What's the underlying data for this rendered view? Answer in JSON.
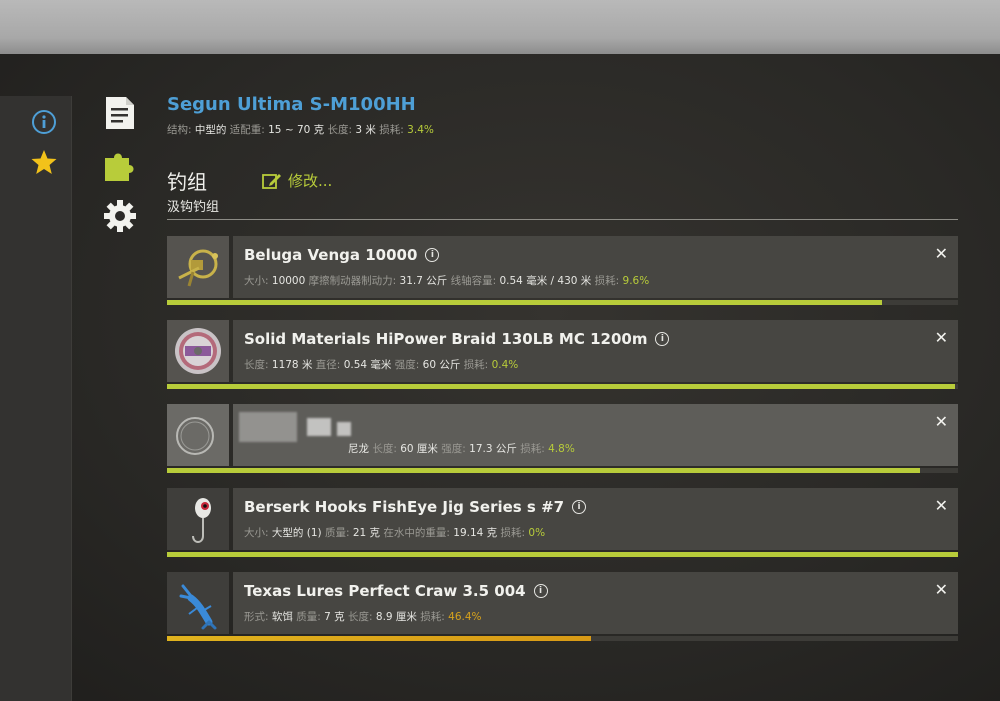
{
  "rod": {
    "name": "Segun Ultima S-M100HH",
    "structure_label": "结构:",
    "structure_value": "中型的",
    "load_label": "适配重:",
    "load_value": "15 ~ 70 克",
    "length_label": "长度:",
    "length_value": "3 米",
    "wear_label": "损耗:",
    "wear_value": "3.4%"
  },
  "rig": {
    "title": "钓组",
    "subtitle": "汲钩钓组",
    "edit_label": "修改..."
  },
  "items": [
    {
      "name": "Beluga Venga 10000",
      "stats": [
        {
          "label": "大小:",
          "value": "10000"
        },
        {
          "label": "摩擦制动器制动力:",
          "value": "31.7 公斤"
        },
        {
          "label": "线轴容量:",
          "value": "0.54 毫米 / 430 米"
        },
        {
          "label": "损耗:",
          "value": "9.6%"
        }
      ],
      "condition": 0.904
    },
    {
      "name": "Solid Materials HiPower Braid 130LB MC 1200m",
      "stats": [
        {
          "label": "长度:",
          "value": "1178 米"
        },
        {
          "label": "直径:",
          "value": "0.54 毫米"
        },
        {
          "label": "强度:",
          "value": "60 公斤"
        },
        {
          "label": "损耗:",
          "value": "0.4%"
        }
      ],
      "condition": 0.996
    },
    {
      "name": "",
      "stats": [
        {
          "label": "尼龙",
          "value": ""
        },
        {
          "label": "长度:",
          "value": "60 厘米"
        },
        {
          "label": "强度:",
          "value": "17.3 公斤"
        },
        {
          "label": "损耗:",
          "value": "4.8%"
        }
      ],
      "condition": 0.952
    },
    {
      "name": "Berserk Hooks FishEye Jig Series s #7",
      "stats": [
        {
          "label": "大小:",
          "value": "大型的 (1)"
        },
        {
          "label": "质量:",
          "value": "21 克"
        },
        {
          "label": "在水中的重量:",
          "value": "19.14 克"
        },
        {
          "label": "损耗:",
          "value": "0%"
        }
      ],
      "condition": 1.0
    },
    {
      "name": "Texas Lures Perfect Craw 3.5 004",
      "stats": [
        {
          "label": "形式:",
          "value": "软饵"
        },
        {
          "label": "质量:",
          "value": "7 克"
        },
        {
          "label": "长度:",
          "value": "8.9 厘米"
        },
        {
          "label": "损耗:",
          "value": "46.4%"
        }
      ],
      "condition": 0.536
    }
  ],
  "icons": {
    "left": [
      "info-icon",
      "star-icon"
    ],
    "side": [
      "document-icon",
      "puzzle-icon",
      "gear-icon"
    ],
    "edit": "pencil-icon",
    "close": "close-icon",
    "info": "info-icon"
  },
  "colors": {
    "accent_green": "#b8cc3a",
    "title_blue": "#4e9fd6",
    "warning_orange": "#d6a21c",
    "star_yellow": "#f2c21a"
  },
  "glyphs": {
    "info": "i",
    "close": "✕"
  }
}
